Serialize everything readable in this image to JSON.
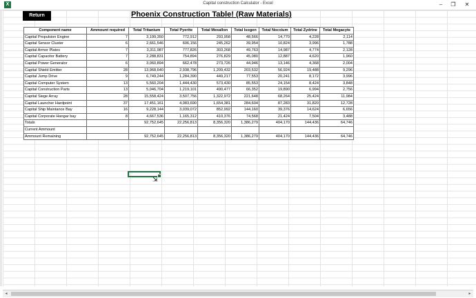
{
  "window": {
    "title": "Capital construction Calculator - Excel",
    "minimize_glyph": "–",
    "restore_glyph": "❐",
    "close_glyph": "✕",
    "app_icon_letter": "X"
  },
  "sheet": {
    "return_label": "Return",
    "title": "Phoenix Construction Table! (Raw Materials)"
  },
  "table": {
    "headers": [
      "Component name",
      "Ammount required",
      "Total Tritanium",
      "Total Pyerite",
      "Total Mexallon",
      "Total Isogen",
      "Total Nocxium",
      "Total Zydrine",
      "Total Megacyte"
    ],
    "rows": [
      [
        "Capital Propulsion Engine",
        "7",
        "3,199,350",
        "772,912",
        "293,958",
        "48,566",
        "14,770",
        "4,228",
        "2,114"
      ],
      [
        "Capital Sensor Cluster",
        "6",
        "2,661,546",
        "606,156",
        "245,262",
        "39,954",
        "10,824",
        "3,996",
        "1,788"
      ],
      [
        "Capital Armor Plates",
        "7",
        "3,311,987",
        "777,826",
        "303,268",
        "49,763",
        "14,987",
        "4,774",
        "2,128"
      ],
      [
        "Capital Capacitor Battery",
        "7",
        "2,288,831",
        "754,894",
        "276,829",
        "45,080",
        "12,887",
        "4,620",
        "1,960"
      ],
      [
        "Capital Power Generator",
        "6",
        "3,060,894",
        "662,478",
        "273,726",
        "44,946",
        "13,146",
        "4,368",
        "2,004"
      ],
      [
        "Capital Shield Emitter",
        "28",
        "13,968,640",
        "2,938,796",
        "1,209,432",
        "203,532",
        "56,924",
        "19,488",
        "9,296"
      ],
      [
        "Capital Jump Drive",
        "9",
        "6,749,244",
        "1,284,390",
        "449,217",
        "77,553",
        "20,241",
        "8,172",
        "3,996"
      ],
      [
        "Capital Computer System",
        "13",
        "5,560,204",
        "1,444,430",
        "573,430",
        "85,553",
        "24,154",
        "8,424",
        "3,848"
      ],
      [
        "Capital Construction Parts",
        "13",
        "5,046,704",
        "1,219,101",
        "490,477",
        "66,352",
        "19,890",
        "6,994",
        "2,756"
      ],
      [
        "Capital Siege Array",
        "28",
        "15,558,424",
        "3,507,756",
        "1,322,972",
        "221,648",
        "68,264",
        "25,424",
        "11,984"
      ],
      [
        "Capital Launcher Hardpoint",
        "37",
        "17,451,161",
        "4,083,690",
        "1,654,381",
        "284,604",
        "87,283",
        "31,820",
        "12,728"
      ],
      [
        "Capital Ship Maintance Bay",
        "16",
        "9,228,144",
        "3,039,072",
        "852,992",
        "144,160",
        "39,376",
        "14,624",
        "6,656"
      ],
      [
        "Capital Corporate Hangar bay",
        "8",
        "4,667,536",
        "1,165,312",
        "410,376",
        "74,568",
        "21,424",
        "7,504",
        "3,488"
      ],
      [
        "Totals",
        "",
        "92,752,645",
        "22,256,813",
        "8,356,320",
        "1,386,279",
        "404,170",
        "144,436",
        "64,746"
      ],
      [
        "Current Ammount",
        "",
        "",
        "",
        "",
        "",
        "",
        "",
        ""
      ],
      [
        "Ammount Remaining",
        "",
        "92,752,645",
        "22,256,813",
        "8,356,320",
        "1,386,279",
        "404,170",
        "144,436",
        "64,746"
      ]
    ]
  },
  "scrollbar": {
    "left_glyph": "◂",
    "right_glyph": "▸"
  },
  "cursor_glyph": "⇲"
}
